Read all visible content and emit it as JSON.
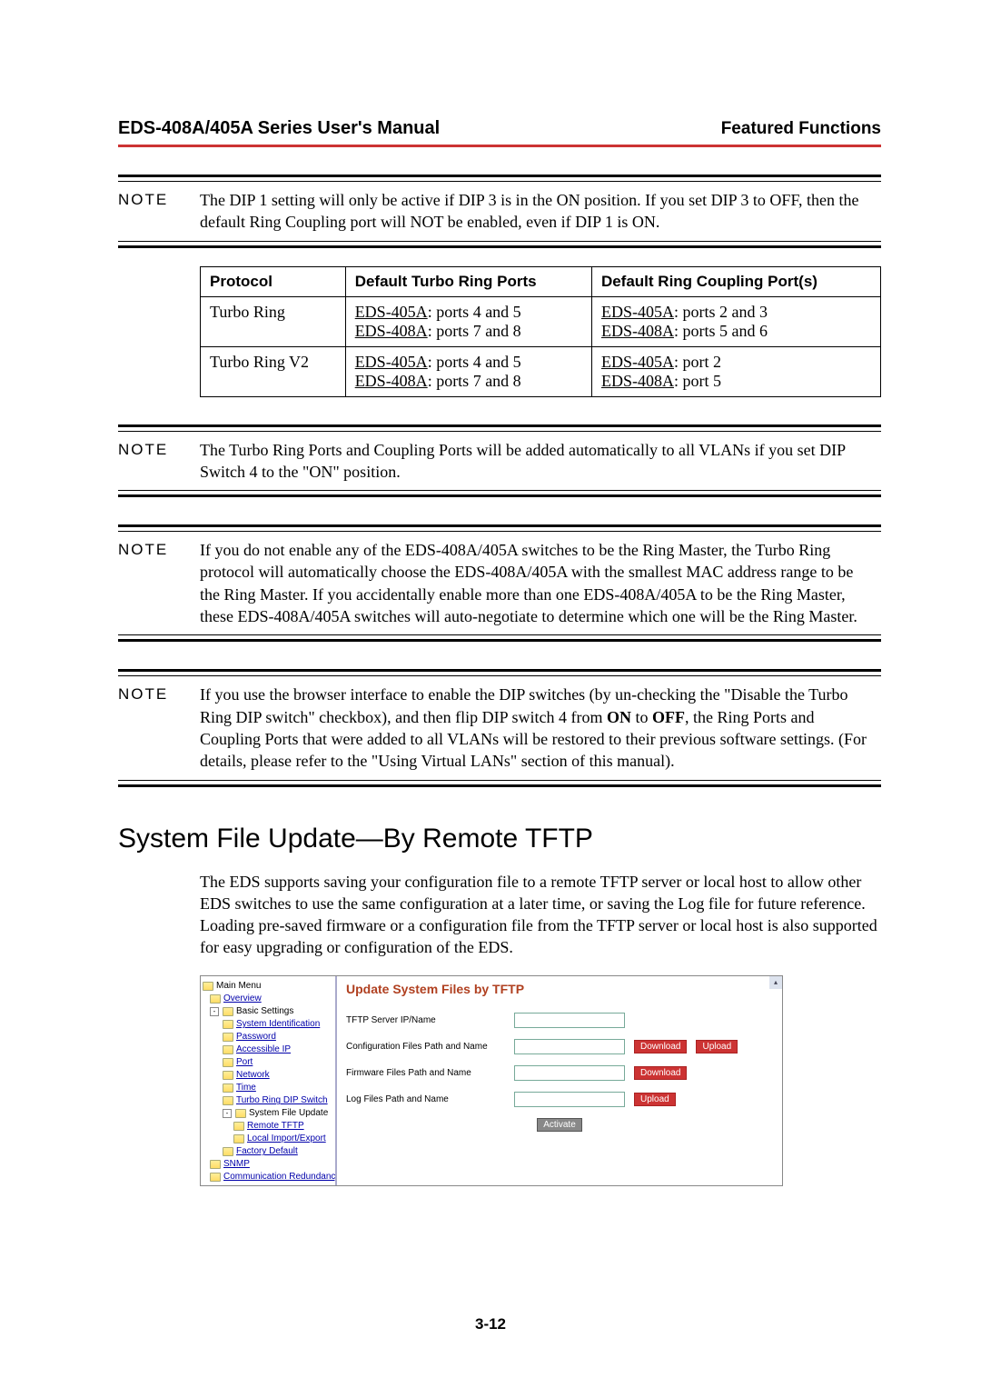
{
  "header": {
    "left": "EDS-408A/405A Series User's Manual",
    "right": "Featured Functions"
  },
  "notes": {
    "label": "NOTE",
    "note1": "The DIP 1 setting will only be active if DIP 3 is in the ON position. If you set DIP 3 to OFF, then the default Ring Coupling port will NOT be enabled, even if DIP 1 is ON.",
    "note2": "The Turbo Ring Ports and Coupling Ports will be added automatically to all VLANs if you set DIP Switch 4 to the \"ON\" position.",
    "note3": "If you do not enable any of the EDS-408A/405A switches to be the Ring Master, the Turbo Ring protocol will automatically choose the EDS-408A/405A with the smallest MAC address range to be the Ring Master. If you accidentally enable more than one EDS-408A/405A to be the Ring Master, these EDS-408A/405A switches will auto-negotiate to determine which one will be the Ring Master.",
    "note4_pre": "If you use the browser interface to enable the DIP switches (by un-checking the \"Disable the Turbo Ring DIP switch\" checkbox), and then flip DIP switch 4 from ",
    "note4_on": "ON",
    "note4_mid": " to ",
    "note4_off": "OFF",
    "note4_post": ", the Ring Ports and Coupling Ports that were added to all VLANs will be restored to their previous software settings. (For details, please refer to the \"Using Virtual LANs\" section of this manual)."
  },
  "table": {
    "headers": {
      "c1": "Protocol",
      "c2": "Default Turbo Ring Ports",
      "c3": "Default Ring Coupling Port(s)"
    },
    "rows": [
      {
        "c1": "Turbo Ring",
        "c2a_u": "EDS-405A",
        "c2a_t": ":  ports 4 and 5",
        "c2b_u": "EDS-408A",
        "c2b_t": ":  ports 7 and 8",
        "c3a_u": "EDS-405A",
        "c3a_t": ":  ports 2 and 3",
        "c3b_u": "EDS-408A",
        "c3b_t": ":  ports 5 and 6"
      },
      {
        "c1": "Turbo Ring V2",
        "c2a_u": "EDS-405A",
        "c2a_t": ":  ports 4 and 5",
        "c2b_u": "EDS-408A",
        "c2b_t": ":  ports 7 and 8",
        "c3a_u": "EDS-405A",
        "c3a_t": ":  port 2",
        "c3b_u": "EDS-408A",
        "c3b_t": ":  port 5"
      }
    ]
  },
  "section": {
    "title": "System File Update—By Remote TFTP",
    "para": "The EDS supports saving your configuration file to a remote TFTP server or local host to allow other EDS switches to use the same configuration at a later time, or saving the Log file for future reference. Loading pre-saved firmware or a configuration file from the TFTP server or local host is also supported for easy upgrading or configuration of the EDS."
  },
  "app": {
    "tree": {
      "main": "Main Menu",
      "overview": "Overview",
      "basic": "Basic Settings",
      "sysid": "System Identification",
      "password": "Password",
      "accip": "Accessible IP",
      "port": "Port",
      "network": "Network",
      "time": "Time",
      "dip": "Turbo Ring DIP Switch",
      "sysfile": "System File Update",
      "rtftp": "Remote TFTP",
      "local": "Local Import/Export",
      "factory": "Factory Default",
      "snmp": "SNMP",
      "commred": "Communication Redundancy"
    },
    "pane": {
      "title": "Update System Files by TFTP",
      "f1": "TFTP Server IP/Name",
      "f2": "Configuration Files Path and Name",
      "f3": "Firmware Files Path and Name",
      "f4": "Log Files Path and Name",
      "download": "Download",
      "upload": "Upload",
      "activate": "Activate"
    }
  },
  "page_number": "3-12"
}
